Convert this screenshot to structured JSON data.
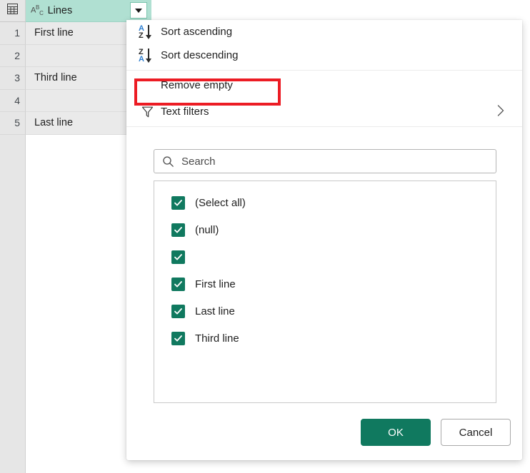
{
  "grid": {
    "column": {
      "type_icon": "abc-text-type-icon",
      "title": "Lines",
      "dropdown_icon": "caret-down-icon"
    },
    "row_number_header": "table-corner-icon",
    "rows": [
      {
        "num": "1",
        "value": "First line",
        "is_null": false
      },
      {
        "num": "2",
        "value": "null",
        "is_null": true
      },
      {
        "num": "3",
        "value": "Third line",
        "is_null": false
      },
      {
        "num": "4",
        "value": "",
        "is_null": false
      },
      {
        "num": "5",
        "value": "Last line",
        "is_null": false
      }
    ]
  },
  "filter_panel": {
    "menu": [
      {
        "id": "sort-ascending",
        "label": "Sort ascending",
        "icon": "sort-ascending-icon",
        "top_letter": "A",
        "bottom_letter": "Z",
        "top_color": "#2f7fd0",
        "bottom_color": "#2b2b2b"
      },
      {
        "id": "sort-descending",
        "label": "Sort descending",
        "icon": "sort-descending-icon",
        "top_letter": "Z",
        "bottom_letter": "A",
        "top_color": "#2b2b2b",
        "bottom_color": "#2f7fd0"
      }
    ],
    "remove_empty": {
      "label": "Remove empty",
      "highlight_color": "#ec1c24"
    },
    "text_filters": {
      "label": "Text filters",
      "icon": "funnel-icon",
      "submenu_icon": "chevron-right-icon"
    },
    "search": {
      "placeholder": "Search",
      "icon": "search-icon",
      "value": ""
    },
    "checkbox_list": [
      {
        "label": "(Select all)",
        "checked": true
      },
      {
        "label": "(null)",
        "checked": true
      },
      {
        "label": "",
        "checked": true
      },
      {
        "label": "First line",
        "checked": true
      },
      {
        "label": "Last line",
        "checked": true
      },
      {
        "label": "Third line",
        "checked": true
      }
    ],
    "buttons": {
      "ok": "OK",
      "cancel": "Cancel"
    },
    "colors": {
      "accent": "#10795f",
      "header": "#b0e0d2",
      "highlight": "#ec1c24"
    }
  }
}
